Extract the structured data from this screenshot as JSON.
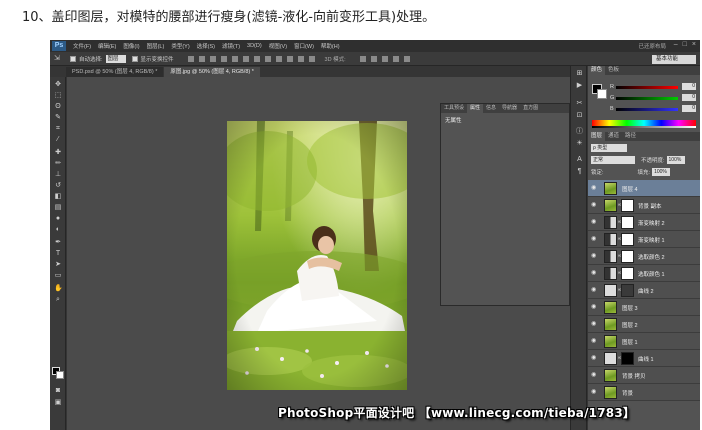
{
  "caption": "10、盖印图层，对模特的腰部进行瘦身(滤镜-液化-向前变形工具)处理。",
  "app": {
    "logo": "Ps",
    "menu": [
      "文件(F)",
      "编辑(E)",
      "图像(I)",
      "图层(L)",
      "类型(Y)",
      "选择(S)",
      "滤镜(T)",
      "3D(D)",
      "视图(V)",
      "窗口(W)",
      "帮助(H)"
    ],
    "layout_label": "已还原布局",
    "window_controls": [
      "–",
      "□",
      "×"
    ]
  },
  "options_bar": {
    "auto_select_label": "自动选择:",
    "auto_select_value": "图层",
    "show_transform_label": "显示变换控件",
    "mode_3d_label": "3D 模式:",
    "workspace": "基本功能"
  },
  "document_tabs": [
    {
      "label": "PSD.psd @ 50% (图层 4, RGB/8) *",
      "active": false
    },
    {
      "label": "原图.jpg @ 50% (图层 4, RGB/8) *",
      "active": true
    }
  ],
  "floating_panel": {
    "tabs": [
      "工具预设",
      "属性",
      "信息",
      "导航器",
      "直方图"
    ],
    "active_tab_index": 1,
    "body_text": "无属性"
  },
  "color_panel": {
    "tabs": [
      "颜色",
      "色板"
    ],
    "channels": [
      {
        "label": "R",
        "value": "0",
        "color": "#d93030"
      },
      {
        "label": "G",
        "value": "0",
        "color": "#2fb02f"
      },
      {
        "label": "B",
        "value": "0",
        "color": "#3050d8"
      }
    ]
  },
  "layers_panel": {
    "tabs": [
      "图层",
      "通道",
      "路径"
    ],
    "kind_filter": "ρ 类型",
    "blend_mode": "正常",
    "opacity_label": "不透明度:",
    "opacity_value": "100%",
    "lock_label": "锁定:",
    "fill_label": "填充:",
    "fill_value": "100%",
    "layers": [
      {
        "name": "图层 4",
        "thumb": "photo",
        "mask": false,
        "selected": true
      },
      {
        "name": "背景 副本",
        "thumb": "photo",
        "mask": "white",
        "selected": false
      },
      {
        "name": "渐变映射 2",
        "thumb": "adjust",
        "mask": "white",
        "selected": false
      },
      {
        "name": "渐变映射 1",
        "thumb": "adjust",
        "mask": "white",
        "selected": false
      },
      {
        "name": "选取颜色 2",
        "thumb": "adjust",
        "mask": "white",
        "selected": false
      },
      {
        "name": "选取颜色 1",
        "thumb": "adjust",
        "mask": "white",
        "selected": false
      },
      {
        "name": "曲线 2",
        "thumb": "curves",
        "mask": "dark",
        "selected": false
      },
      {
        "name": "图层 3",
        "thumb": "photo",
        "mask": false,
        "selected": false
      },
      {
        "name": "图层 2",
        "thumb": "photo",
        "mask": false,
        "selected": false
      },
      {
        "name": "图层 1",
        "thumb": "photo",
        "mask": false,
        "selected": false
      },
      {
        "name": "曲线 1",
        "thumb": "curves",
        "mask": "black",
        "selected": false
      },
      {
        "name": "背景 拷贝",
        "thumb": "photo",
        "mask": false,
        "selected": false
      },
      {
        "name": "背景",
        "thumb": "photo",
        "mask": false,
        "selected": false
      }
    ]
  },
  "watermark": "PhotoShop平面设计吧 【www.linecg.com/tieba/1783】"
}
